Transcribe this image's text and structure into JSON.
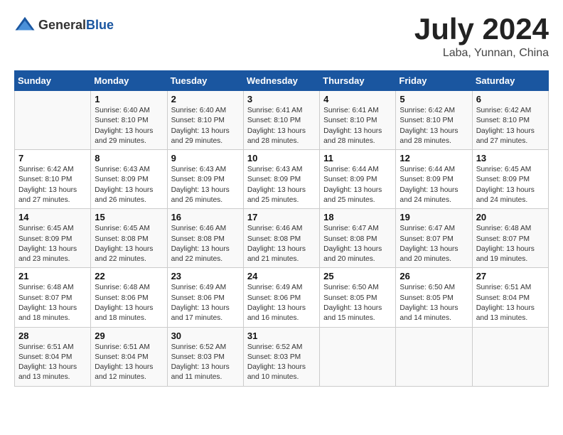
{
  "header": {
    "logo_general": "General",
    "logo_blue": "Blue",
    "month_title": "July 2024",
    "location": "Laba, Yunnan, China"
  },
  "days_of_week": [
    "Sunday",
    "Monday",
    "Tuesday",
    "Wednesday",
    "Thursday",
    "Friday",
    "Saturday"
  ],
  "weeks": [
    [
      {
        "day": "",
        "content": ""
      },
      {
        "day": "1",
        "content": "Sunrise: 6:40 AM\nSunset: 8:10 PM\nDaylight: 13 hours\nand 29 minutes."
      },
      {
        "day": "2",
        "content": "Sunrise: 6:40 AM\nSunset: 8:10 PM\nDaylight: 13 hours\nand 29 minutes."
      },
      {
        "day": "3",
        "content": "Sunrise: 6:41 AM\nSunset: 8:10 PM\nDaylight: 13 hours\nand 28 minutes."
      },
      {
        "day": "4",
        "content": "Sunrise: 6:41 AM\nSunset: 8:10 PM\nDaylight: 13 hours\nand 28 minutes."
      },
      {
        "day": "5",
        "content": "Sunrise: 6:42 AM\nSunset: 8:10 PM\nDaylight: 13 hours\nand 28 minutes."
      },
      {
        "day": "6",
        "content": "Sunrise: 6:42 AM\nSunset: 8:10 PM\nDaylight: 13 hours\nand 27 minutes."
      }
    ],
    [
      {
        "day": "7",
        "content": "Sunrise: 6:42 AM\nSunset: 8:10 PM\nDaylight: 13 hours\nand 27 minutes."
      },
      {
        "day": "8",
        "content": "Sunrise: 6:43 AM\nSunset: 8:09 PM\nDaylight: 13 hours\nand 26 minutes."
      },
      {
        "day": "9",
        "content": "Sunrise: 6:43 AM\nSunset: 8:09 PM\nDaylight: 13 hours\nand 26 minutes."
      },
      {
        "day": "10",
        "content": "Sunrise: 6:43 AM\nSunset: 8:09 PM\nDaylight: 13 hours\nand 25 minutes."
      },
      {
        "day": "11",
        "content": "Sunrise: 6:44 AM\nSunset: 8:09 PM\nDaylight: 13 hours\nand 25 minutes."
      },
      {
        "day": "12",
        "content": "Sunrise: 6:44 AM\nSunset: 8:09 PM\nDaylight: 13 hours\nand 24 minutes."
      },
      {
        "day": "13",
        "content": "Sunrise: 6:45 AM\nSunset: 8:09 PM\nDaylight: 13 hours\nand 24 minutes."
      }
    ],
    [
      {
        "day": "14",
        "content": "Sunrise: 6:45 AM\nSunset: 8:09 PM\nDaylight: 13 hours\nand 23 minutes."
      },
      {
        "day": "15",
        "content": "Sunrise: 6:45 AM\nSunset: 8:08 PM\nDaylight: 13 hours\nand 22 minutes."
      },
      {
        "day": "16",
        "content": "Sunrise: 6:46 AM\nSunset: 8:08 PM\nDaylight: 13 hours\nand 22 minutes."
      },
      {
        "day": "17",
        "content": "Sunrise: 6:46 AM\nSunset: 8:08 PM\nDaylight: 13 hours\nand 21 minutes."
      },
      {
        "day": "18",
        "content": "Sunrise: 6:47 AM\nSunset: 8:08 PM\nDaylight: 13 hours\nand 20 minutes."
      },
      {
        "day": "19",
        "content": "Sunrise: 6:47 AM\nSunset: 8:07 PM\nDaylight: 13 hours\nand 20 minutes."
      },
      {
        "day": "20",
        "content": "Sunrise: 6:48 AM\nSunset: 8:07 PM\nDaylight: 13 hours\nand 19 minutes."
      }
    ],
    [
      {
        "day": "21",
        "content": "Sunrise: 6:48 AM\nSunset: 8:07 PM\nDaylight: 13 hours\nand 18 minutes."
      },
      {
        "day": "22",
        "content": "Sunrise: 6:48 AM\nSunset: 8:06 PM\nDaylight: 13 hours\nand 18 minutes."
      },
      {
        "day": "23",
        "content": "Sunrise: 6:49 AM\nSunset: 8:06 PM\nDaylight: 13 hours\nand 17 minutes."
      },
      {
        "day": "24",
        "content": "Sunrise: 6:49 AM\nSunset: 8:06 PM\nDaylight: 13 hours\nand 16 minutes."
      },
      {
        "day": "25",
        "content": "Sunrise: 6:50 AM\nSunset: 8:05 PM\nDaylight: 13 hours\nand 15 minutes."
      },
      {
        "day": "26",
        "content": "Sunrise: 6:50 AM\nSunset: 8:05 PM\nDaylight: 13 hours\nand 14 minutes."
      },
      {
        "day": "27",
        "content": "Sunrise: 6:51 AM\nSunset: 8:04 PM\nDaylight: 13 hours\nand 13 minutes."
      }
    ],
    [
      {
        "day": "28",
        "content": "Sunrise: 6:51 AM\nSunset: 8:04 PM\nDaylight: 13 hours\nand 13 minutes."
      },
      {
        "day": "29",
        "content": "Sunrise: 6:51 AM\nSunset: 8:04 PM\nDaylight: 13 hours\nand 12 minutes."
      },
      {
        "day": "30",
        "content": "Sunrise: 6:52 AM\nSunset: 8:03 PM\nDaylight: 13 hours\nand 11 minutes."
      },
      {
        "day": "31",
        "content": "Sunrise: 6:52 AM\nSunset: 8:03 PM\nDaylight: 13 hours\nand 10 minutes."
      },
      {
        "day": "",
        "content": ""
      },
      {
        "day": "",
        "content": ""
      },
      {
        "day": "",
        "content": ""
      }
    ]
  ]
}
